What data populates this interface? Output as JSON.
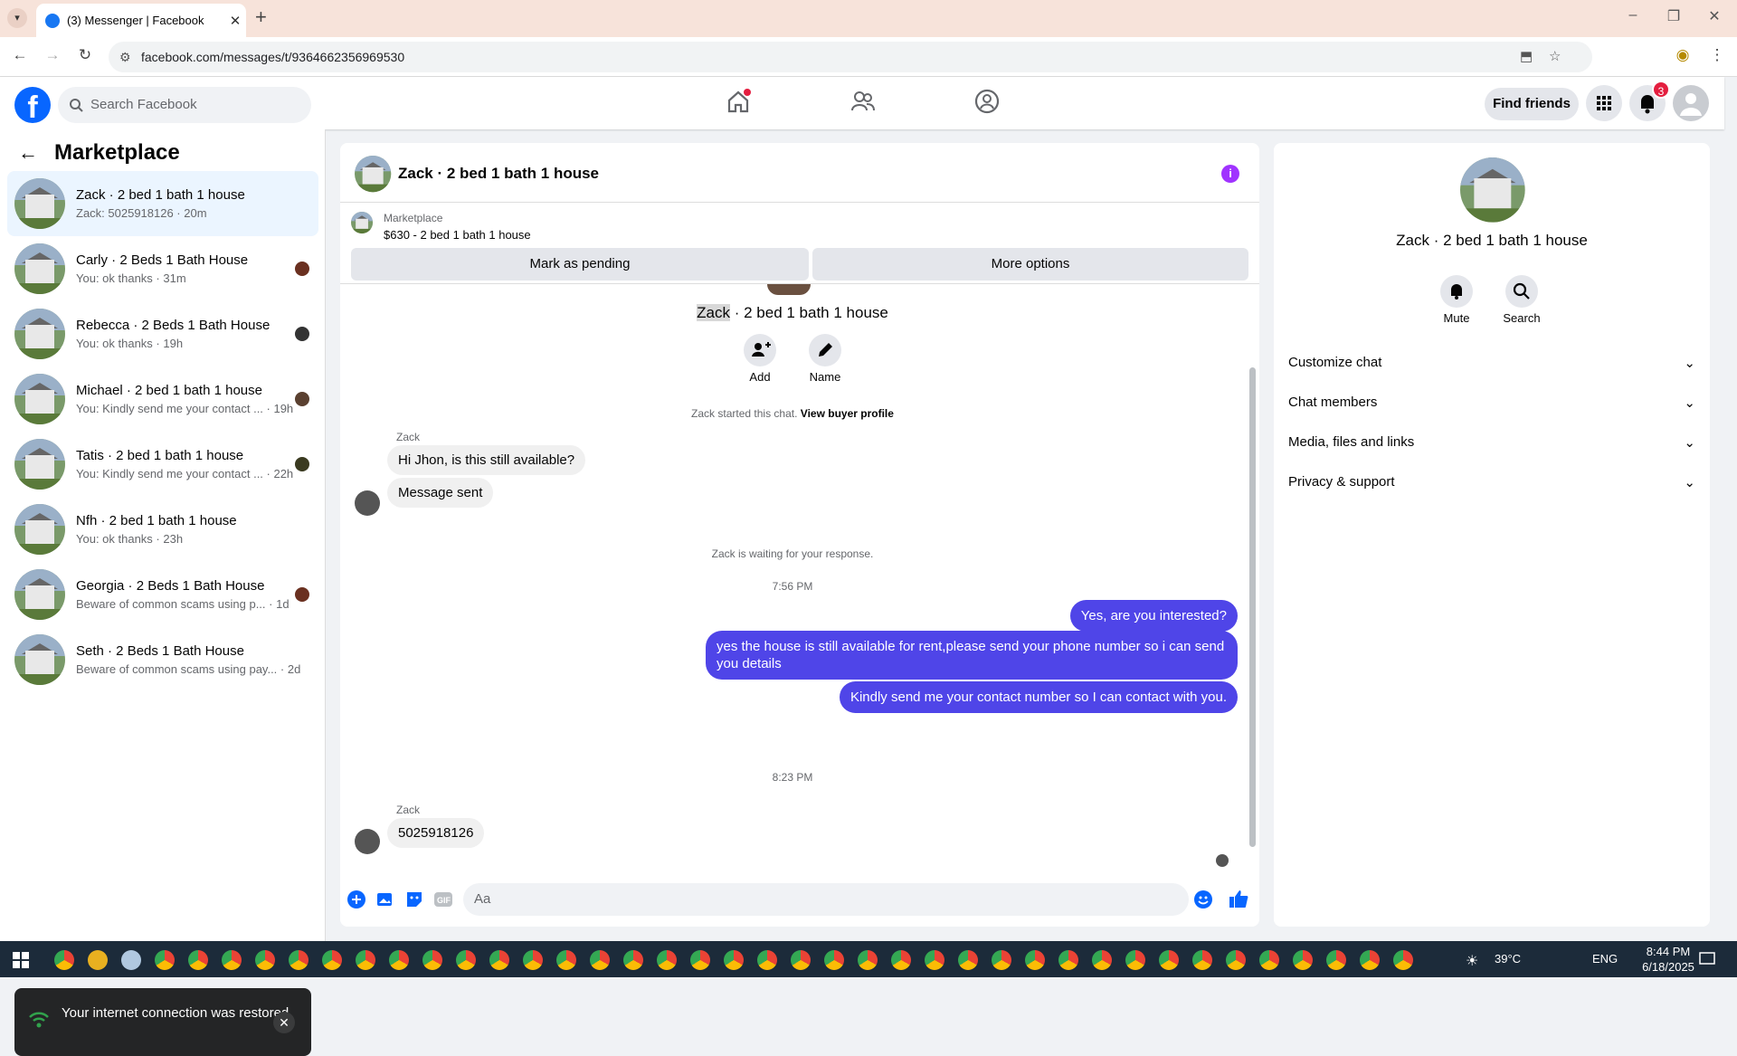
{
  "browser": {
    "tab_title": "(3) Messenger | Facebook",
    "url": "facebook.com/messages/t/9364662356969530"
  },
  "fb": {
    "search_placeholder": "Search Facebook",
    "find_friends": "Find friends",
    "notif_count": "3"
  },
  "left": {
    "title": "Marketplace",
    "conversations": [
      {
        "name": "Zack · 2 bed 1 bath 1 house",
        "preview": "Zack: 5025918126 · 20m",
        "active": true
      },
      {
        "name": "Carly · 2 Beds 1 Bath House",
        "preview": "You: ok thanks · 31m"
      },
      {
        "name": "Rebecca · 2 Beds 1 Bath House",
        "preview": "You: ok thanks · 19h"
      },
      {
        "name": "Michael · 2 bed 1 bath 1 house",
        "preview": "You: Kindly send me your contact ... · 19h"
      },
      {
        "name": "Tatis · 2 bed 1 bath 1 house",
        "preview": "You: Kindly send me your contact ... · 22h"
      },
      {
        "name": "Nfh · 2 bed 1 bath 1 house",
        "preview": "You: ok thanks · 23h"
      },
      {
        "name": "Georgia · 2 Beds 1 Bath House",
        "preview": "Beware of common scams using p... · 1d"
      },
      {
        "name": "Seth · 2 Beds 1 Bath House",
        "preview": "Beware of common scams using pay... · 2d"
      }
    ]
  },
  "toast": {
    "text": "Your internet connection was restored."
  },
  "chat": {
    "title": "Zack · 2 bed 1 bath 1 house",
    "marketplace_label": "Marketplace",
    "listing": "$630 - 2 bed 1 bath 1 house",
    "mark_pending": "Mark as pending",
    "more_options": "More options",
    "intro_name_hl": "Zack",
    "intro_rest": "· 2 bed 1 bath 1 house",
    "add_label": "Add",
    "name_label": "Name",
    "started_text": "Zack started this chat.",
    "view_profile": "View buyer profile",
    "sender1": "Zack",
    "msg_in_1": "Hi Jhon, is this still available?",
    "msg_in_2": "Message sent",
    "waiting": "Zack is waiting for your response.",
    "time1": "7:56 PM",
    "msg_out_1": "Yes, are you interested?",
    "msg_out_2": "yes the house is still available for rent,please send your  phone number so i can send you details",
    "msg_out_3": "Kindly send me your contact number so I can contact with you.",
    "time2": "8:23 PM",
    "sender2": "Zack",
    "msg_in_3": "5025918126",
    "composer_placeholder": "Aa"
  },
  "right": {
    "name": "Zack · 2 bed 1 bath 1 house",
    "mute": "Mute",
    "search": "Search",
    "sections": [
      "Customize chat",
      "Chat members",
      "Media, files and links",
      "Privacy & support"
    ]
  },
  "taskbar": {
    "temp": "39°C",
    "lang": "ENG",
    "time": "8:44 PM",
    "date": "6/18/2025"
  },
  "colors": {
    "accent": "#0866ff",
    "outgoing_bubble": "#4f45e8",
    "info": "#a033ff"
  }
}
